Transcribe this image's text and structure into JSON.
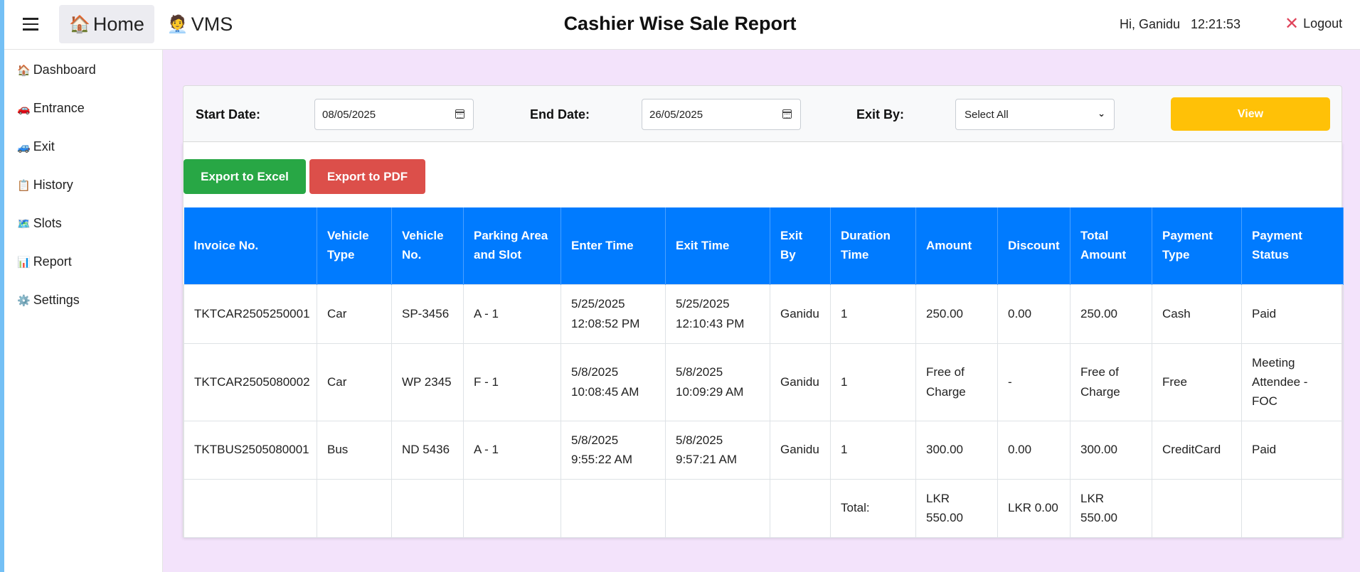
{
  "header": {
    "home_emoji": "🏠",
    "home_label": "Home",
    "vms_emoji": "🧑‍💼",
    "vms_label": "VMS",
    "title": "Cashier Wise Sale Report",
    "greeting": "Hi, Ganidu",
    "time": "12:21:53",
    "logout_label": "Logout"
  },
  "sidebar": {
    "items": [
      {
        "icon": "🏠",
        "label": "Dashboard"
      },
      {
        "icon": "🚗",
        "label": "Entrance"
      },
      {
        "icon": "🚙",
        "label": "Exit"
      },
      {
        "icon": "📋",
        "label": "History"
      },
      {
        "icon": "🗺️",
        "label": "Slots"
      },
      {
        "icon": "📊",
        "label": "Report"
      },
      {
        "icon": "⚙️",
        "label": "Settings"
      }
    ]
  },
  "filters": {
    "start_label": "Start Date:",
    "start_value": "08/05/2025",
    "end_label": "End Date:",
    "end_value": "26/05/2025",
    "exit_by_label": "Exit By:",
    "exit_by_value": "Select All",
    "view_label": "View"
  },
  "actions": {
    "excel_label": "Export to Excel",
    "pdf_label": "Export to PDF"
  },
  "table": {
    "headers": [
      "Invoice No.",
      "Vehicle Type",
      "Vehicle No.",
      "Parking Area and Slot",
      "Enter Time",
      "Exit Time",
      "Exit By",
      "Duration Time",
      "Amount",
      "Discount",
      "Total Amount",
      "Payment Type",
      "Payment Status"
    ],
    "rows": [
      [
        "TKTCAR2505250001",
        "Car",
        "SP-3456",
        "A - 1",
        "5/25/2025 12:08:52 PM",
        "5/25/2025 12:10:43 PM",
        "Ganidu",
        "1",
        "250.00",
        "0.00",
        "250.00",
        "Cash",
        "Paid"
      ],
      [
        "TKTCAR2505080002",
        "Car",
        "WP 2345",
        "F - 1",
        "5/8/2025 10:08:45 AM",
        "5/8/2025 10:09:29 AM",
        "Ganidu",
        "1",
        "Free of Charge",
        "-",
        "Free of Charge",
        "Free",
        "Meeting Attendee - FOC"
      ],
      [
        "TKTBUS2505080001",
        "Bus",
        "ND 5436",
        "A - 1",
        "5/8/2025 9:55:22 AM",
        "5/8/2025 9:57:21 AM",
        "Ganidu",
        "1",
        "300.00",
        "0.00",
        "300.00",
        "CreditCard",
        "Paid"
      ]
    ],
    "total_label": "Total:",
    "total_amount": "LKR 550.00",
    "total_discount": "LKR 0.00",
    "total_total": "LKR 550.00"
  }
}
